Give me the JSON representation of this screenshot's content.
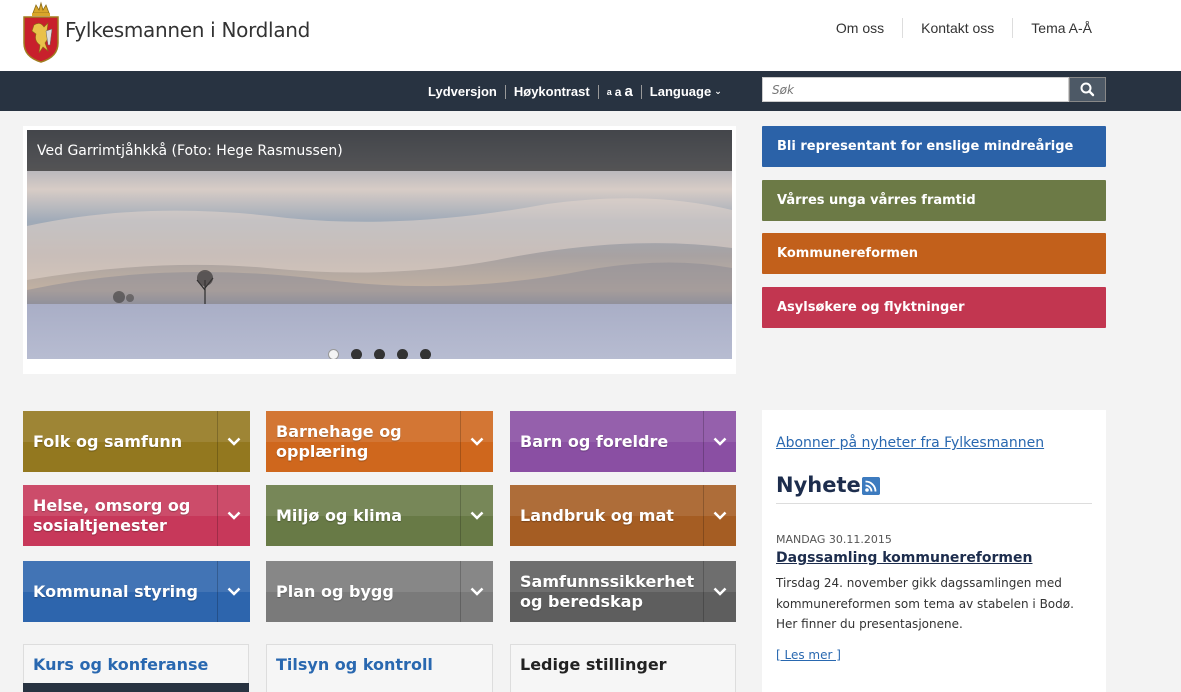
{
  "header": {
    "site_title": "Fylkesmannen i Nordland",
    "nav": [
      "Om oss",
      "Kontakt oss",
      "Tema A-Å"
    ]
  },
  "toolbar": {
    "audio": "Lydversjon",
    "contrast": "Høykontrast",
    "font_small": "a",
    "font_medium": "a",
    "font_large": "a",
    "language": "Language",
    "search_placeholder": "Søk",
    "color": "#283341"
  },
  "slider": {
    "caption": "Ved Garrimtjåhkkå (Foto: Hege Rasmussen)",
    "slide_count": 5,
    "active_slide": 1
  },
  "promos": [
    {
      "label": "Bli representant for enslige mindreårige",
      "color": "#2b62a8"
    },
    {
      "label": "Vårres unga vårres framtid",
      "color": "#6c7a46"
    },
    {
      "label": "Kommunereformen",
      "color": "#c2601b"
    },
    {
      "label": "Asylsøkere og flyktninger",
      "color": "#c23650"
    }
  ],
  "tiles": [
    {
      "label": "Folk og samfunn",
      "color": "#93781f"
    },
    {
      "label": "Barnehage og opplæring",
      "color": "#cf671d"
    },
    {
      "label": "Barn og foreldre",
      "color": "#8a4fa3"
    },
    {
      "label": "Helse, omsorg og sosialtjenester",
      "color": "#c7385a"
    },
    {
      "label": "Miljø og klima",
      "color": "#687a46"
    },
    {
      "label": "Landbruk og mat",
      "color": "#a55d23"
    },
    {
      "label": "Kommunal styring",
      "color": "#2d65ad"
    },
    {
      "label": "Plan og bygg",
      "color": "#7a7a7a"
    },
    {
      "label": "Samfunnssikkerhet og beredskap",
      "color": "#5e5e5e"
    }
  ],
  "boxes": [
    "Kurs og konferanse",
    "Tilsyn og kontroll",
    "Ledige stillinger"
  ],
  "news": {
    "subscribe": "Abonner på nyheter fra Fylkesmannen",
    "title": "Nyheter",
    "date": "MANDAG 30.11.2015",
    "headline": "Dagssamling kommunereformen",
    "body": "Tirsdag 24. november gikk dagssamlingen med kommunereformen som tema av stabelen i Bodø. Her finner du presentasjonene.",
    "read_more": "[ Les mer ]"
  }
}
